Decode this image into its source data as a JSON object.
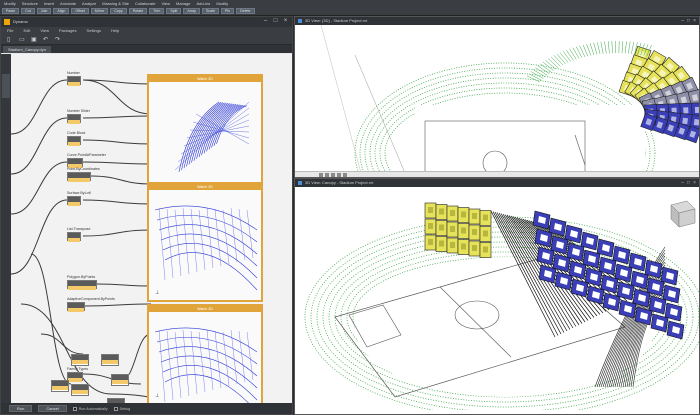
{
  "ribbon": {
    "tabs": [
      "Modify",
      "Structure",
      "Insert",
      "Annotate",
      "Analyze",
      "Massing & Site",
      "Collaborate",
      "View",
      "Manage",
      "Add-Ins",
      "Modify"
    ],
    "tools": [
      "Paste",
      "Cut",
      "Join",
      "Align",
      "Offset",
      "Mirror",
      "Copy",
      "Rotate",
      "Trim",
      "Split",
      "Array",
      "Scale",
      "Pin",
      "Delete"
    ]
  },
  "dynamo": {
    "title": "Dynamo",
    "menu": [
      "File",
      "Edit",
      "View",
      "Packages",
      "Settings",
      "Help"
    ],
    "tab": "Stadium_Canopy.dyn",
    "nodes": [
      {
        "label": "Number"
      },
      {
        "label": "Number Slider"
      },
      {
        "label": "Code Block"
      },
      {
        "label": "Curve.PointAtParameter"
      },
      {
        "label": "Point.ByCoordinates"
      },
      {
        "label": "Surface.ByLoft"
      },
      {
        "label": "List.Transpose"
      },
      {
        "label": "Polygon.ByPoints"
      },
      {
        "label": "AdaptiveComponent.ByPoints"
      },
      {
        "label": "Family Types"
      }
    ],
    "watches": [
      "Watch 3D",
      "Watch 3D",
      "Watch 3D"
    ],
    "footer": {
      "run_label": "Run",
      "cancel_label": "Cancel",
      "auto_label": "Run Automatically",
      "debug_label": "Debug"
    }
  },
  "view_top": {
    "title": "3D View: {3D} - Stadium Project.rvt"
  },
  "view_bottom": {
    "title": "3D View: Canopy - Stadium Project.rvt"
  },
  "colors": {
    "accent": "#e1a43a",
    "canopy_yellow": "#e6e35a",
    "canopy_blue": "#3a3fb8",
    "grass_green": "#3da84a",
    "window_chrome": "#2f3237"
  }
}
